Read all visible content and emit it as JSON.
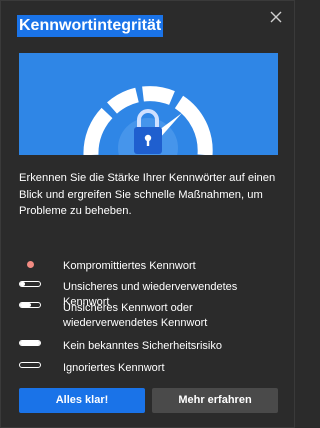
{
  "dialog": {
    "title": "Kennwortintegrität",
    "description": "Erkennen Sie die Stärke Ihrer Kennwörter auf einen Blick und ergreifen Sie schnelle Maßnahmen, um Probleme zu beheben.",
    "legend": [
      {
        "icon": "compromised-dot-icon",
        "label": "Kompromittiertes Kennwort"
      },
      {
        "icon": "strength-low-icon",
        "label": "Unsicheres und wiederverwendetes Kennwort"
      },
      {
        "icon": "strength-medium-icon",
        "label": "Unsicheres Kennwort oder wiederverwendetes Kennwort"
      },
      {
        "icon": "strength-full-icon",
        "label": "Kein bekanntes Sicherheitsrisiko"
      },
      {
        "icon": "ignored-icon",
        "label": "Ignoriertes Kennwort"
      }
    ],
    "buttons": {
      "primary": "Alles klar!",
      "secondary": "Mehr erfahren"
    }
  },
  "colors": {
    "background": "#2b2b2b",
    "accent": "#1a73e8",
    "hero_blue": "#2f86e6",
    "lock_body": "#1f5fcf",
    "compromised": "#f28b82",
    "secondary_button": "#4a4a4a"
  }
}
